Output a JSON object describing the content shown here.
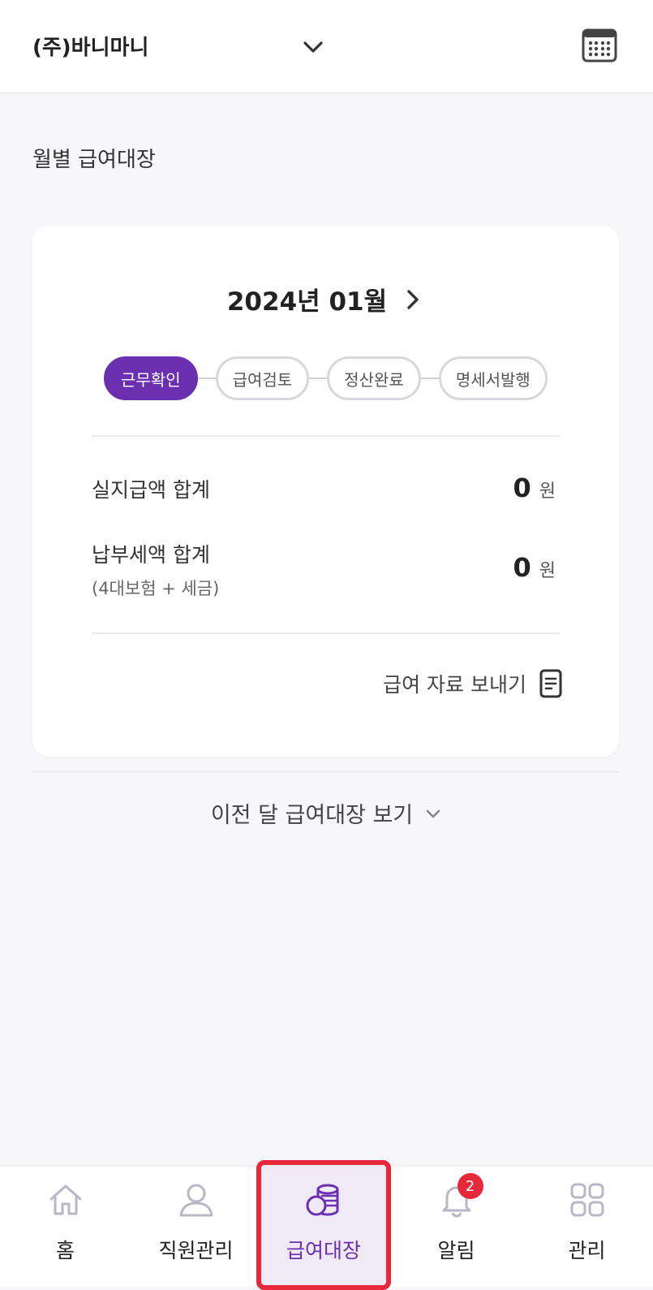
{
  "header": {
    "company": "(주)바니마니",
    "dropdown_icon": "chevron-down-icon",
    "calendar_icon": "calendar-icon"
  },
  "section": {
    "title": "월별 급여대장"
  },
  "card": {
    "period": "2024년 01월",
    "steps": [
      "근무확인",
      "급여검토",
      "정산완료",
      "명세서발행"
    ],
    "active_step": "근무확인",
    "net_pay_label": "실지급액 합계",
    "net_pay_value": "0",
    "tax_label": "납부세액 합계",
    "tax_sub": "(4대보험 + 세금)",
    "tax_value": "0",
    "currency": "원",
    "send_label": "급여 자료 보내기"
  },
  "prev": {
    "label": "이전 달 급여대장 보기"
  },
  "tabbar": {
    "items": [
      {
        "label": "홈",
        "icon": "home-icon"
      },
      {
        "label": "직원관리",
        "icon": "person-icon"
      },
      {
        "label": "급여대장",
        "icon": "coins-icon"
      },
      {
        "label": "알림",
        "icon": "bell-icon",
        "badge": "2"
      },
      {
        "label": "관리",
        "icon": "grid-icon"
      }
    ],
    "active": "급여대장"
  },
  "colors": {
    "accent": "#6b30b0",
    "badge": "#e5283a",
    "highlight_border": "#e5283a"
  }
}
